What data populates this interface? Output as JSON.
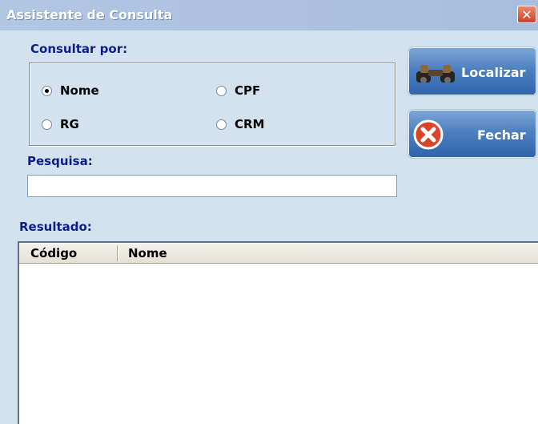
{
  "window": {
    "title": "Assistente de Consulta",
    "close_glyph": "✕"
  },
  "consult": {
    "group_label": "Consultar por:",
    "options": [
      {
        "label": "Nome",
        "checked": true
      },
      {
        "label": "CPF",
        "checked": false
      },
      {
        "label": "RG",
        "checked": false
      },
      {
        "label": "CRM",
        "checked": false
      }
    ]
  },
  "search": {
    "label": "Pesquisa:",
    "value": ""
  },
  "buttons": {
    "find_label": "Localizar",
    "find_icon": "binoculars-icon",
    "close_label": "Fechar",
    "close_icon": "close-circle-icon"
  },
  "results": {
    "label": "Resultado:",
    "columns": [
      "Código",
      "Nome"
    ],
    "rows": []
  },
  "colors": {
    "label_blue": "#0a1f8c",
    "button_blue": "#2f63ab",
    "close_red": "#d9452a"
  }
}
